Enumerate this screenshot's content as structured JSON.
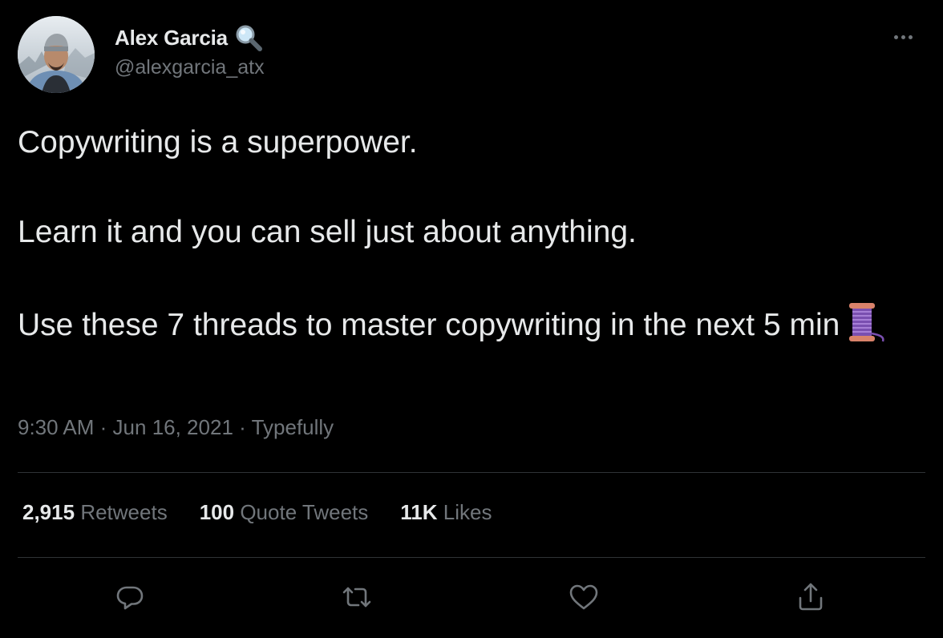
{
  "author": {
    "display_name": "Alex Garcia",
    "handle": "@alexgarcia_atx",
    "avatar": "profile-photo",
    "name_emoji": "magnifying-glass-icon"
  },
  "tweet": {
    "lines": [
      "Copywriting is a superpower.",
      "Learn it and you can sell just about anything.",
      "Use these 7 threads to master copywriting in the next 5 min"
    ],
    "trailing_emoji": "thread-spool-icon"
  },
  "meta": {
    "time": "9:30 AM",
    "separator": "·",
    "date": "Jun 16, 2021",
    "source": "Typefully"
  },
  "stats": [
    {
      "count": "2,915",
      "label": "Retweets"
    },
    {
      "count": "100",
      "label": "Quote Tweets"
    },
    {
      "count": "11K",
      "label": "Likes"
    }
  ],
  "actions": [
    "reply-icon",
    "retweet-icon",
    "like-icon",
    "share-icon"
  ],
  "colors": {
    "background": "#000000",
    "text_primary": "#e7e9ea",
    "text_secondary": "#71767b",
    "divider": "#2f3336"
  }
}
